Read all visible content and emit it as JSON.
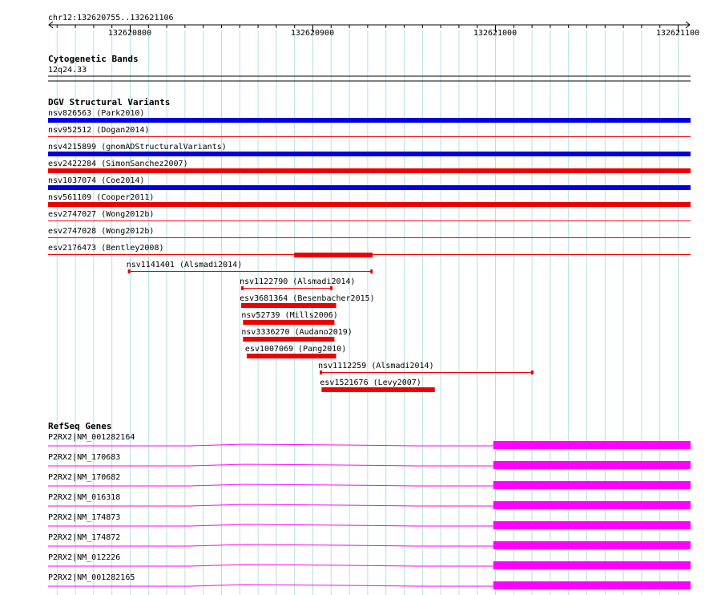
{
  "ruler": {
    "region": "chr12:132620755..132621106",
    "start": 132620755,
    "end": 132621106,
    "ticks": [
      "132620800",
      "132620900",
      "132621000",
      "132621100"
    ]
  },
  "cytobands": {
    "title": "Cytogenetic Bands",
    "band": "12q24.33"
  },
  "dgv": {
    "title": "DGV Structural Variants",
    "colors": {
      "gain": "#0000dd",
      "loss": "#ee0000"
    },
    "full_rows": [
      {
        "label": "nsv826563 (Park2010)",
        "type": "gain",
        "style": "thick"
      },
      {
        "label": "nsv952512 (Dogan2014)",
        "type": "loss",
        "style": "thin"
      },
      {
        "label": "nsv4215899 (gnomADStructuralVariants)",
        "type": "gain",
        "style": "thick"
      },
      {
        "label": "esv2422284 (SimonSanchez2007)",
        "type": "loss",
        "style": "thick"
      },
      {
        "label": "nsv1037074 (Coe2014)",
        "type": "gain",
        "style": "thick"
      },
      {
        "label": "nsv561109 (Cooper2011)",
        "type": "loss",
        "style": "thick"
      },
      {
        "label": "esv2747027 (Wong2012b)",
        "type": "loss",
        "style": "thin"
      },
      {
        "label": "esv2747028 (Wong2012b)",
        "type": "loss",
        "style": "thin"
      },
      {
        "label": "esv2176473 (Bentley2008)",
        "type": "loss",
        "style": "thin"
      }
    ],
    "partial_features": [
      {
        "label": "",
        "start": 132620890,
        "end": 132620933,
        "style": "thick"
      },
      {
        "label": "nsv1141401 (Alsmadi2014)",
        "start": 132620799,
        "end": 132620933,
        "style": "ends"
      },
      {
        "label": "nsv1122790 (Alsmadi2014)",
        "start": 132620861,
        "end": 132620911,
        "style": "ends"
      },
      {
        "label": "esv3681364 (Besenbacher2015)",
        "start": 132620861,
        "end": 132620913,
        "style": "thick"
      },
      {
        "label": "nsv52739 (Mills2006)",
        "start": 132620862,
        "end": 132620912,
        "style": "thick"
      },
      {
        "label": "nsv3336270 (Audano2019)",
        "start": 132620862,
        "end": 132620912,
        "style": "thick"
      },
      {
        "label": "esv1007069 (Pang2010)",
        "start": 132620864,
        "end": 132620913,
        "style": "thick"
      },
      {
        "label": "nsv1112259 (Alsmadi2014)",
        "start": 132620904,
        "end": 132621021,
        "style": "ends"
      },
      {
        "label": "esv1521676 (Levy2007)",
        "start": 132620905,
        "end": 132620967,
        "style": "thick"
      }
    ]
  },
  "refseq": {
    "title": "RefSeq Genes",
    "color": "#ff00ff",
    "exon_start": 132620999,
    "genes": [
      "P2RX2|NM_001282164",
      "P2RX2|NM_170683",
      "P2RX2|NM_170682",
      "P2RX2|NM_016318",
      "P2RX2|NM_174873",
      "P2RX2|NM_174872",
      "P2RX2|NM_012226",
      "P2RX2|NM_001282165"
    ]
  }
}
